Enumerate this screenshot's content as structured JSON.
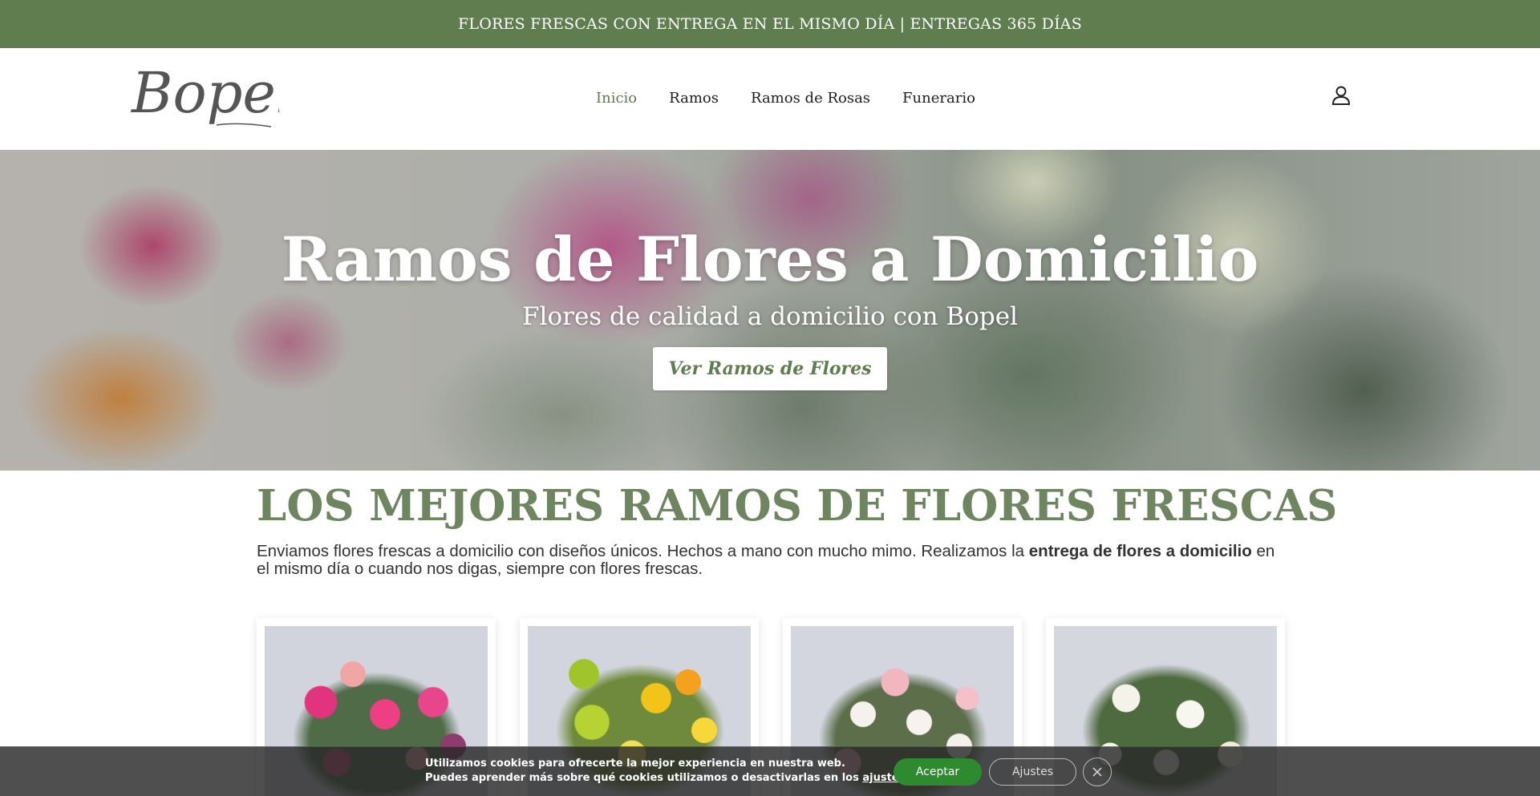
{
  "topbar": {
    "text": "FLORES FRESCAS CON ENTREGA EN EL MISMO DÍA | ENTREGAS 365 DÍAS",
    "bg_color": "#5f7d4f"
  },
  "header": {
    "logo_text": "Bopel",
    "nav": [
      {
        "label": "Inicio",
        "active": true
      },
      {
        "label": "Ramos",
        "active": false
      },
      {
        "label": "Ramos de Rosas",
        "active": false
      },
      {
        "label": "Funerario",
        "active": false
      }
    ],
    "account_icon": "user-icon"
  },
  "hero": {
    "title": "Ramos de Flores a Domicilio",
    "subtitle": "Flores de calidad a domicilio con Bopel",
    "button_label": "Ver Ramos de Flores"
  },
  "section": {
    "title_light": "LOS MEJORES RAMOS ",
    "title_bold": "DE FLORES FRESCAS",
    "text_before": "Enviamos flores frescas a domicilio con diseños únicos. Hechos a mano con mucho mimo. Realizamos la ",
    "text_bold": "entrega de flores a domicilio",
    "text_after": " en el mismo día o cuando nos digas, siempre con flores frescas.",
    "accent_color": "#6e8660"
  },
  "cookie": {
    "line1": "Utilizamos cookies para ofrecerte la mejor experiencia en nuestra web.",
    "line2_before": "Puedes aprender más sobre qué cookies utilizamos o desactivarlas en los ",
    "line2_link": "ajustes",
    "line2_after": ".",
    "accept_label": "Aceptar",
    "settings_label": "Ajustes",
    "close_icon": "close-icon",
    "accept_color": "#2e8a2e"
  }
}
